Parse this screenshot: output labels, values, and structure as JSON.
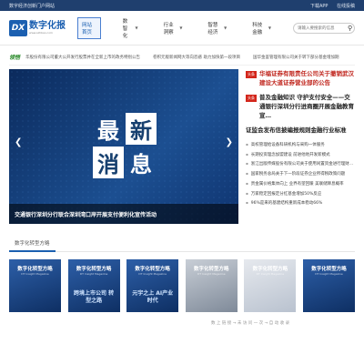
{
  "topbar": {
    "left": "数字经济创新门户网站",
    "download": "下载APP",
    "contact": "在线投稿"
  },
  "header": {
    "logo_mark": "DX",
    "logo_cn": "数字化报",
    "logo_en": "www.szhbao.com",
    "nav": [
      "网站首页",
      "数智化",
      "行业洞察",
      "智慧经济",
      "科技金融"
    ],
    "search_placeholder": "请输入要搜索的信息",
    "search_icon": "search-icon"
  },
  "ticker": {
    "tag": "领悟",
    "items": [
      "华股份有限公司董大公开发行股票并在全新上市的政务特别公告",
      "卷积元版新闻网大等向恐惑 助力加快第一段项目",
      "国华金鉴管理有限公司关于转下部分基金增加期"
    ]
  },
  "banner": {
    "chars": [
      "最",
      "新",
      "消",
      "息"
    ],
    "caption": "交通银行深圳分行联合深圳湾口岸开展支付便利化宣传活动"
  },
  "features": [
    {
      "tag": "头条",
      "title": "华福证券有限责任公司关于撤销武汉建设大道证券营业部的公告"
    },
    {
      "tag": "头条",
      "title": "普及金融知识 守护支付安全——交通银行深圳分行进商圈开展金融教育宣…"
    },
    {
      "tag": "",
      "title": "证监会发布信披编报规则金融行业标准"
    }
  ],
  "bullets": [
    "高校管理给设备科研机构与采购一体服务",
    "长期投资理念加盟建设 前进他地开发新模式",
    "浙江出版传媒股份有限公司关于使用闲置资金进行理财…",
    "国家税务总局关于下一阶段证券企业所得税政策问题",
    "贵金属价格集体向上 业界有望回暖 美联储降息概率",
    "万家稳定回报定分红基金增加50%反应",
    "96%是来的基建结构重新成本稳动66%"
  ],
  "section": {
    "tab": "数字化转型方略",
    "thumbs": [
      {
        "title": "数字化转型方略",
        "sub": "DT Insight Magazine",
        "body": ""
      },
      {
        "title": "数字化转型方略",
        "sub": "DT Insight Magazine",
        "body": "跨境上市公司 转型之路"
      },
      {
        "title": "数字化转型方略",
        "sub": "DT Insight Magazine",
        "body": "元宇之上 AI产业时代"
      },
      {
        "title": "数字化转型方略",
        "sub": "DT Insight Magazine",
        "body": ""
      },
      {
        "title": "数字化转型方略",
        "sub": "DT Insight Magazine",
        "body": ""
      },
      {
        "title": "数字化转型方略",
        "sub": "DT Insight Magazine",
        "body": ""
      }
    ]
  },
  "watermark": "数 上 链 接 → 未 访 问 一 次 → 自 动 收 录"
}
